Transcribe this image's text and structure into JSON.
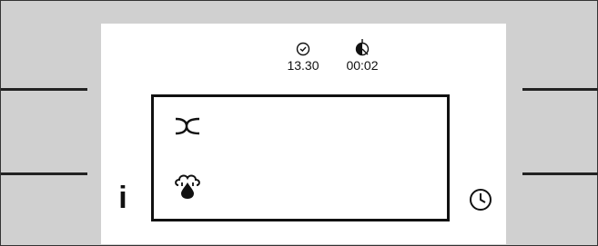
{
  "status": {
    "time_icon": "clock-check-icon",
    "time": "13.30",
    "duration_icon": "timer-icon",
    "duration": "00:02"
  },
  "menu": {
    "items": [
      {
        "icon": "two-curves-icon"
      },
      {
        "icon": "steam-drop-icon"
      }
    ]
  },
  "buttons": {
    "info_label": "i",
    "clock_icon": "clock-icon"
  }
}
